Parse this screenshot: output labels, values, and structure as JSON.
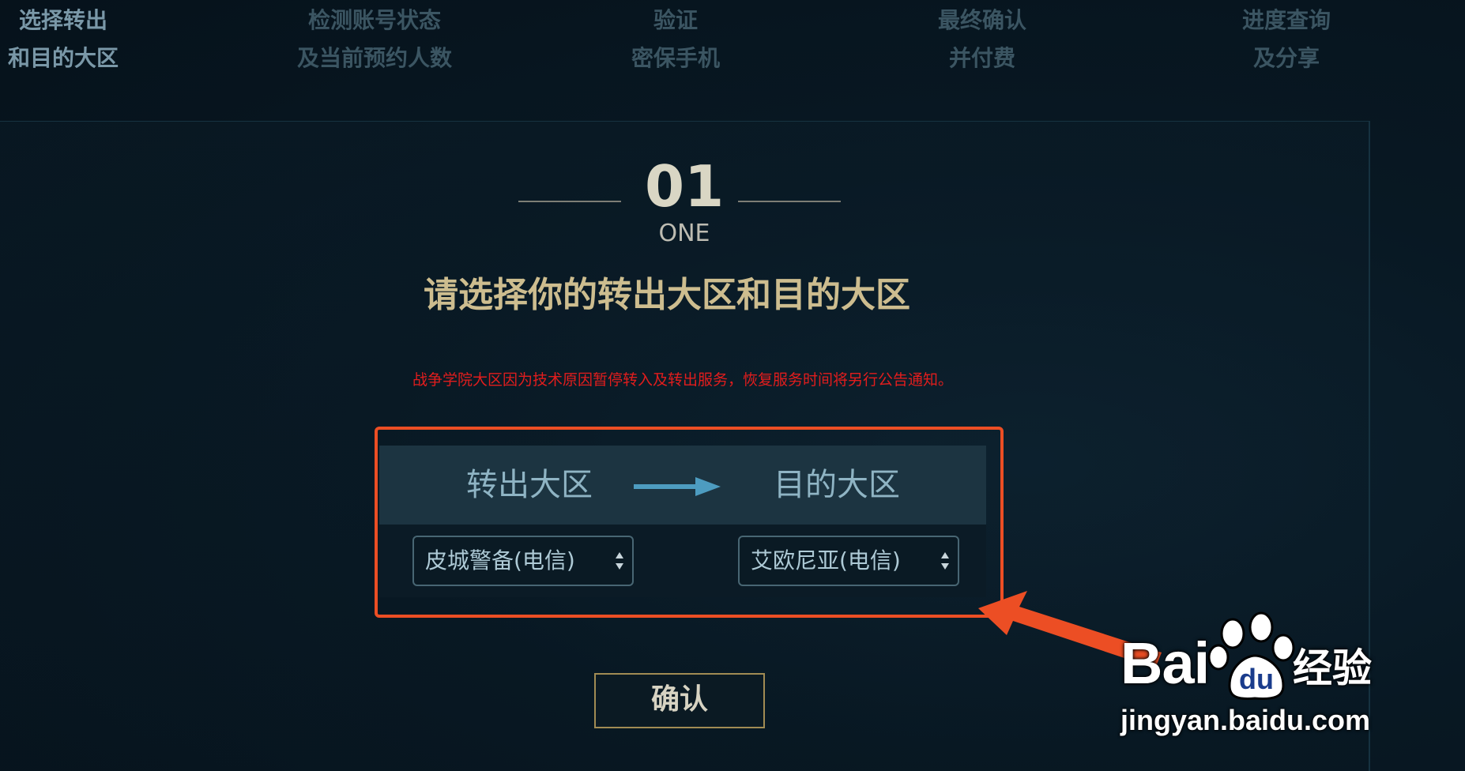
{
  "steps": [
    {
      "line1": "选择转出",
      "line2": "和目的大区",
      "active": true
    },
    {
      "line1": "检测账号状态",
      "line2": "及当前预约人数",
      "active": false
    },
    {
      "line1": "验证",
      "line2": "密保手机",
      "active": false
    },
    {
      "line1": "最终确认",
      "line2": "并付费",
      "active": false
    },
    {
      "line1": "进度查询",
      "line2": "及分享",
      "active": false
    }
  ],
  "step_header": {
    "number": "01",
    "subtitle": "ONE"
  },
  "title": "请选择你的转出大区和目的大区",
  "notice": "战争学院大区因为技术原因暂停转入及转出服务，恢复服务时间将另行公告通知。",
  "transfer": {
    "from_label": "转出大区",
    "to_label": "目的大区",
    "from_value": "皮城警备(电信)",
    "to_value": "艾欧尼亚(电信)"
  },
  "confirm_label": "确认",
  "watermark": {
    "brand": "Bai",
    "brand_suffix": "经验",
    "url": "jingyan.baidu.com"
  },
  "colors": {
    "accent_gold": "#cdbd8f",
    "notice_red": "#e21d1d",
    "highlight_orange": "#ec4e24",
    "header_blue": "#8fb4c4"
  }
}
